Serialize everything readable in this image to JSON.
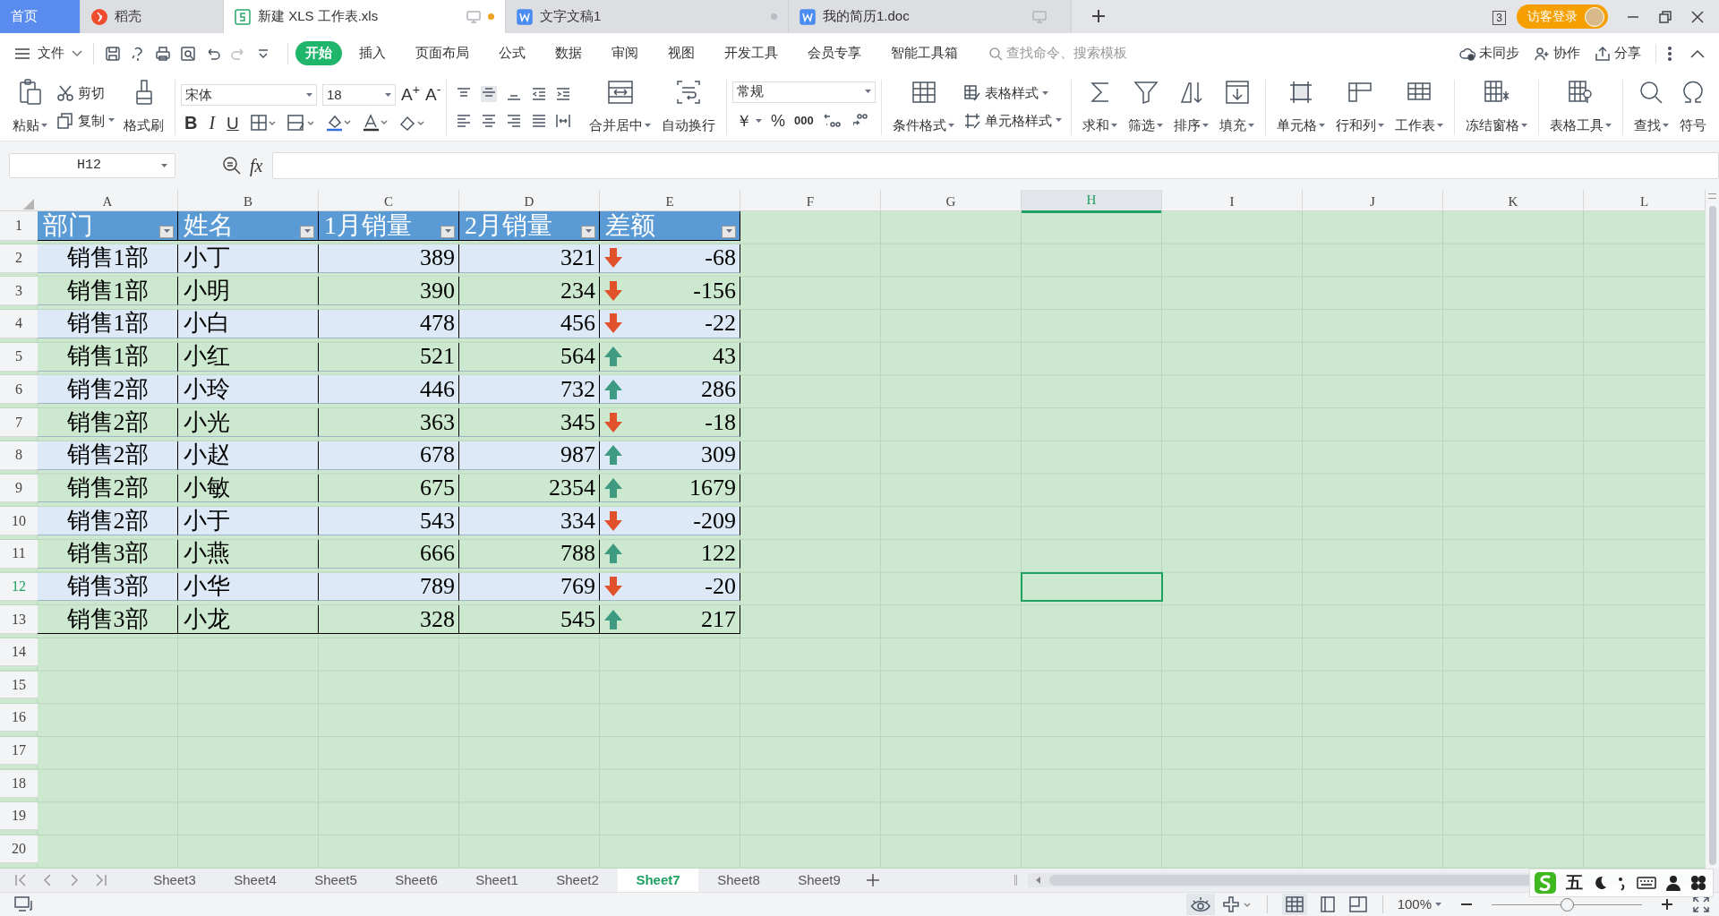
{
  "doc_tabs": [
    {
      "label": "首页",
      "kind": "home",
      "selected": false
    },
    {
      "label": "稻壳",
      "kind": "daoke",
      "selected": false
    },
    {
      "label": "新建 XLS 工作表.xls",
      "kind": "sheet",
      "selected": true,
      "modified": true
    },
    {
      "label": "文字文稿1",
      "kind": "word",
      "selected": false,
      "modified": true
    },
    {
      "label": "我的简历1.doc",
      "kind": "word",
      "selected": false,
      "modified": false
    }
  ],
  "page_count": "3",
  "login_button": "访客登录",
  "menu": {
    "file": "文件",
    "items": [
      {
        "label": "开始",
        "selected": true
      },
      {
        "label": "插入",
        "selected": false
      },
      {
        "label": "页面布局",
        "selected": false
      },
      {
        "label": "公式",
        "selected": false
      },
      {
        "label": "数据",
        "selected": false
      },
      {
        "label": "审阅",
        "selected": false
      },
      {
        "label": "视图",
        "selected": false
      },
      {
        "label": "开发工具",
        "selected": false
      },
      {
        "label": "会员专享",
        "selected": false
      },
      {
        "label": "智能工具箱",
        "selected": false
      }
    ],
    "search_placeholder": "查找命令、搜索模板",
    "actions": [
      "未同步",
      "协作",
      "分享"
    ]
  },
  "ribbon": {
    "paste": "粘贴",
    "cut": "剪切",
    "copy": "复制",
    "format_painter": "格式刷",
    "font_family": "宋体",
    "font_size": "18",
    "grow_font": "A$^{+}$",
    "shrink_font": "A$^{-}$",
    "bold": "B",
    "italic": "I",
    "underline": "U",
    "merge": "合并居中",
    "wrap": "自动换行",
    "number_format": "常规",
    "currency": "￥",
    "percent": "%",
    "thousands": "000",
    "styles": [
      "表格样式",
      "单元格样式"
    ],
    "large_buttons": [
      "条件格式",
      "求和",
      "筛选",
      "排序",
      "填充",
      "单元格",
      "行和列",
      "工作表",
      "冻结窗格",
      "表格工具",
      "查找",
      "符号"
    ]
  },
  "formula_bar": {
    "name_box": "H12",
    "fx": "fx"
  },
  "columns": [
    {
      "label": "A",
      "selected": false
    },
    {
      "label": "B",
      "selected": false
    },
    {
      "label": "C",
      "selected": false
    },
    {
      "label": "D",
      "selected": false
    },
    {
      "label": "E",
      "selected": false
    },
    {
      "label": "F",
      "selected": false
    },
    {
      "label": "G",
      "selected": false
    },
    {
      "label": "H",
      "selected": true
    },
    {
      "label": "I",
      "selected": false
    },
    {
      "label": "J",
      "selected": false
    },
    {
      "label": "K",
      "selected": false
    },
    {
      "label": "L",
      "selected": false
    }
  ],
  "row_numbers": [
    {
      "label": "1",
      "selected": false
    },
    {
      "label": "2",
      "selected": false
    },
    {
      "label": "3",
      "selected": false
    },
    {
      "label": "4",
      "selected": false
    },
    {
      "label": "5",
      "selected": false
    },
    {
      "label": "6",
      "selected": false
    },
    {
      "label": "7",
      "selected": false
    },
    {
      "label": "8",
      "selected": false
    },
    {
      "label": "9",
      "selected": false
    },
    {
      "label": "10",
      "selected": false
    },
    {
      "label": "11",
      "selected": false
    },
    {
      "label": "12",
      "selected": true
    },
    {
      "label": "13",
      "selected": false
    },
    {
      "label": "14",
      "selected": false
    },
    {
      "label": "15",
      "selected": false
    },
    {
      "label": "16",
      "selected": false
    },
    {
      "label": "17",
      "selected": false
    },
    {
      "label": "18",
      "selected": false
    },
    {
      "label": "19",
      "selected": false
    },
    {
      "label": "20",
      "selected": false
    }
  ],
  "table": {
    "headers": [
      "部门",
      "姓名",
      "1月销量",
      "2月销量",
      "差额"
    ],
    "rows": [
      {
        "dept": "销售1部",
        "name": "小丁",
        "jan": "389",
        "feb": "321",
        "kind": "down",
        "diff": "-68"
      },
      {
        "dept": "销售1部",
        "name": "小明",
        "jan": "390",
        "feb": "234",
        "kind": "down",
        "diff": "-156"
      },
      {
        "dept": "销售1部",
        "name": "小白",
        "jan": "478",
        "feb": "456",
        "kind": "down",
        "diff": "-22"
      },
      {
        "dept": "销售1部",
        "name": "小红",
        "jan": "521",
        "feb": "564",
        "kind": "up",
        "diff": "43"
      },
      {
        "dept": "销售2部",
        "name": "小玲",
        "jan": "446",
        "feb": "732",
        "kind": "up",
        "diff": "286"
      },
      {
        "dept": "销售2部",
        "name": "小光",
        "jan": "363",
        "feb": "345",
        "kind": "down",
        "diff": "-18"
      },
      {
        "dept": "销售2部",
        "name": "小赵",
        "jan": "678",
        "feb": "987",
        "kind": "up",
        "diff": "309"
      },
      {
        "dept": "销售2部",
        "name": "小敏",
        "jan": "675",
        "feb": "2354",
        "kind": "up",
        "diff": "1679"
      },
      {
        "dept": "销售2部",
        "name": "小于",
        "jan": "543",
        "feb": "334",
        "kind": "down",
        "diff": "-209"
      },
      {
        "dept": "销售3部",
        "name": "小燕",
        "jan": "666",
        "feb": "788",
        "kind": "up",
        "diff": "122"
      },
      {
        "dept": "销售3部",
        "name": "小华",
        "jan": "789",
        "feb": "769",
        "kind": "down",
        "diff": "-20"
      },
      {
        "dept": "销售3部",
        "name": "小龙",
        "jan": "328",
        "feb": "545",
        "kind": "up",
        "diff": "217"
      }
    ]
  },
  "sheet_tabs": [
    {
      "label": "Sheet3",
      "selected": false
    },
    {
      "label": "Sheet4",
      "selected": false
    },
    {
      "label": "Sheet5",
      "selected": false
    },
    {
      "label": "Sheet6",
      "selected": false
    },
    {
      "label": "Sheet1",
      "selected": false
    },
    {
      "label": "Sheet2",
      "selected": false
    },
    {
      "label": "Sheet7",
      "selected": true
    },
    {
      "label": "Sheet8",
      "selected": false
    },
    {
      "label": "Sheet9",
      "selected": false
    }
  ],
  "status_bar": {
    "zoom": "100%",
    "zoom_slider": {
      "level": 0.5
    }
  },
  "ime_toolbar": {
    "mode": "五"
  }
}
